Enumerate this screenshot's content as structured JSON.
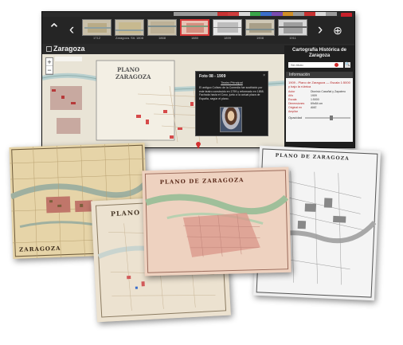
{
  "app": {
    "brand": "Zaragoza",
    "accent_strip": [
      "#9a9a9a",
      "#9a9a9a",
      "#9a9a9a",
      "#9a9a9a",
      "#c93232",
      "#cf3d3d",
      "#d9d9d9",
      "#3aa64a",
      "#3a6ecb",
      "#7a4bb0",
      "#d08f28",
      "#9a9a9a",
      "#c93232",
      "#d9d9d9",
      "#9a9a9a"
    ]
  },
  "timeline": {
    "up_icon": "chevron-up-icon",
    "prev_icon": "chevron-left-icon",
    "next_icon": "chevron-right-icon",
    "zoom_icon": "zoom-icon",
    "thumbnails": [
      {
        "caption": "1712",
        "tone": "#cbbf9c"
      },
      {
        "caption": "Zaragoza. Sit. 1808",
        "tone": "#d4c8a4"
      },
      {
        "caption": "1868",
        "tone": "#c8bda0"
      },
      {
        "caption": "1880",
        "tone": "#cf9b8f"
      },
      {
        "caption": "1899",
        "tone": "#d9d9d9"
      },
      {
        "caption": "1908",
        "tone": "#bdb6a4"
      },
      {
        "caption": "1911",
        "tone": "#c5c5c5"
      }
    ]
  },
  "map": {
    "zoom_in": "+",
    "zoom_out": "−"
  },
  "popup": {
    "title": "Foto 08 - 1909",
    "close": "×",
    "link": "Teatro Principal",
    "text": "El antiguo Coliseo de la Comedia fue sustituido por este teatro construido en 1799 y reformado en 1858. Fachada hacia el Coso, junto a la actual plaza de España, según el plano."
  },
  "sidebar": {
    "title": "Cartografía Histórica de Zaragoza",
    "search_value": "Sin título",
    "search_icon": "search-icon",
    "tab_label": "Información",
    "doc_title": "1909 - Plano de Zaragoza — Escala 1:5000 y bajo la rúbrica",
    "fields": [
      {
        "k": "Autor",
        "v": "Dionisio Casañal y Zapatero"
      },
      {
        "k": "Año",
        "v": "1909"
      },
      {
        "k": "Escala",
        "v": "1:5000"
      },
      {
        "k": "Dimensiones",
        "v": "69x84 cm"
      },
      {
        "k": "Original en",
        "v": "AMZ"
      },
      {
        "k": "Ampliar",
        "v": ""
      }
    ],
    "opacity_label": "Opacidad"
  },
  "sheets": [
    {
      "title": "PLANO DE ZARAGOZA",
      "tone": "#e2cfa0"
    },
    {
      "title": "ZARAGOZA",
      "tone": "#e4d4b0"
    },
    {
      "title": "PLANO DE ZARAGOZA",
      "tone": "#e8dcc6"
    },
    {
      "title": "PLANO DE ZARAGOZA",
      "tone": "#ecc9b6"
    },
    {
      "title": "PLANO DE ZARAGOZA",
      "tone": "#ededed"
    }
  ]
}
